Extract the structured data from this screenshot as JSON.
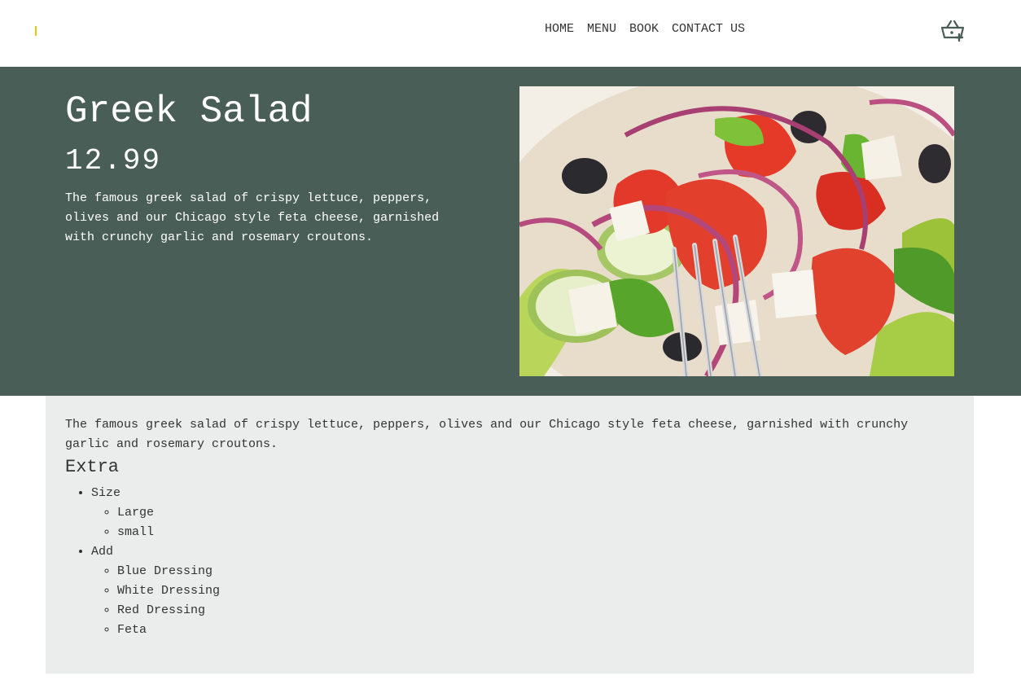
{
  "nav": {
    "links": [
      "HOME",
      "MENU",
      "BOOK",
      "CONTACT US"
    ],
    "cart_icon": "basket-plus-icon"
  },
  "toggle": {
    "state": "on",
    "color": "#1a82f7"
  },
  "dish": {
    "name": "Greek Salad",
    "price": "12.99",
    "short_description": "The famous greek salad of crispy lettuce, peppers, olives and our Chicago style feta cheese, garnished with crunchy garlic and rosemary croutons.",
    "description": "The famous greek salad of crispy lettuce, peppers, olives and our Chicago style feta cheese, garnished with crunchy garlic and rosemary croutons."
  },
  "extra": {
    "heading": "Extra",
    "groups": [
      {
        "label": "Size",
        "options": [
          "Large",
          "small"
        ]
      },
      {
        "label": "Add",
        "options": [
          "Blue Dressing",
          "White Dressing",
          "Red Dressing",
          "Feta"
        ]
      }
    ]
  },
  "colors": {
    "hero_bg": "#495e57",
    "details_bg": "#ebedec",
    "logo_accent": "#f2c200"
  }
}
